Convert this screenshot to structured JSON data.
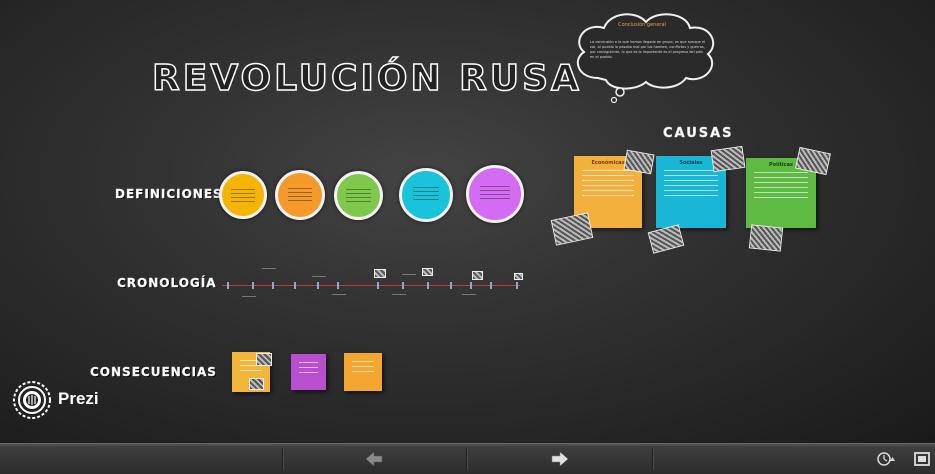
{
  "presentation": {
    "title": "REVOLUCIÓN RUSA"
  },
  "sections": {
    "definiciones": "DEFINICIONES",
    "cronologia": "CRONOLOGÍA",
    "consecuencias": "CONSECUENCIAS",
    "causas": "CAUSAS"
  },
  "definitions": {
    "circles": [
      {
        "color": "#f5b400"
      },
      {
        "color": "#f39a2b"
      },
      {
        "color": "#7ec94c"
      },
      {
        "color": "#19c3d9"
      },
      {
        "color": "#d36cf2"
      }
    ]
  },
  "causas": {
    "notes": [
      {
        "header": "Económicas",
        "color": "#f2b13c"
      },
      {
        "header": "Sociales",
        "color": "#19b6d6"
      },
      {
        "header": "Políticas",
        "color": "#5fba43"
      }
    ]
  },
  "consecuencias": {
    "notes": [
      {
        "color": "#f3b43a"
      },
      {
        "color": "#b84fd0"
      },
      {
        "color": "#f4a730"
      }
    ]
  },
  "cloud": {
    "title": "Conclusión general",
    "body": "La conclusión a la que hemos llegado en grupo, es que aunque el zar, al pueblo lo pasaba mal por los hambre, conflictos y guerras, por consiguiente, lo que es lo importante es el progreso del país en el pueblo."
  },
  "branding": {
    "logo_text": "Prezi"
  }
}
